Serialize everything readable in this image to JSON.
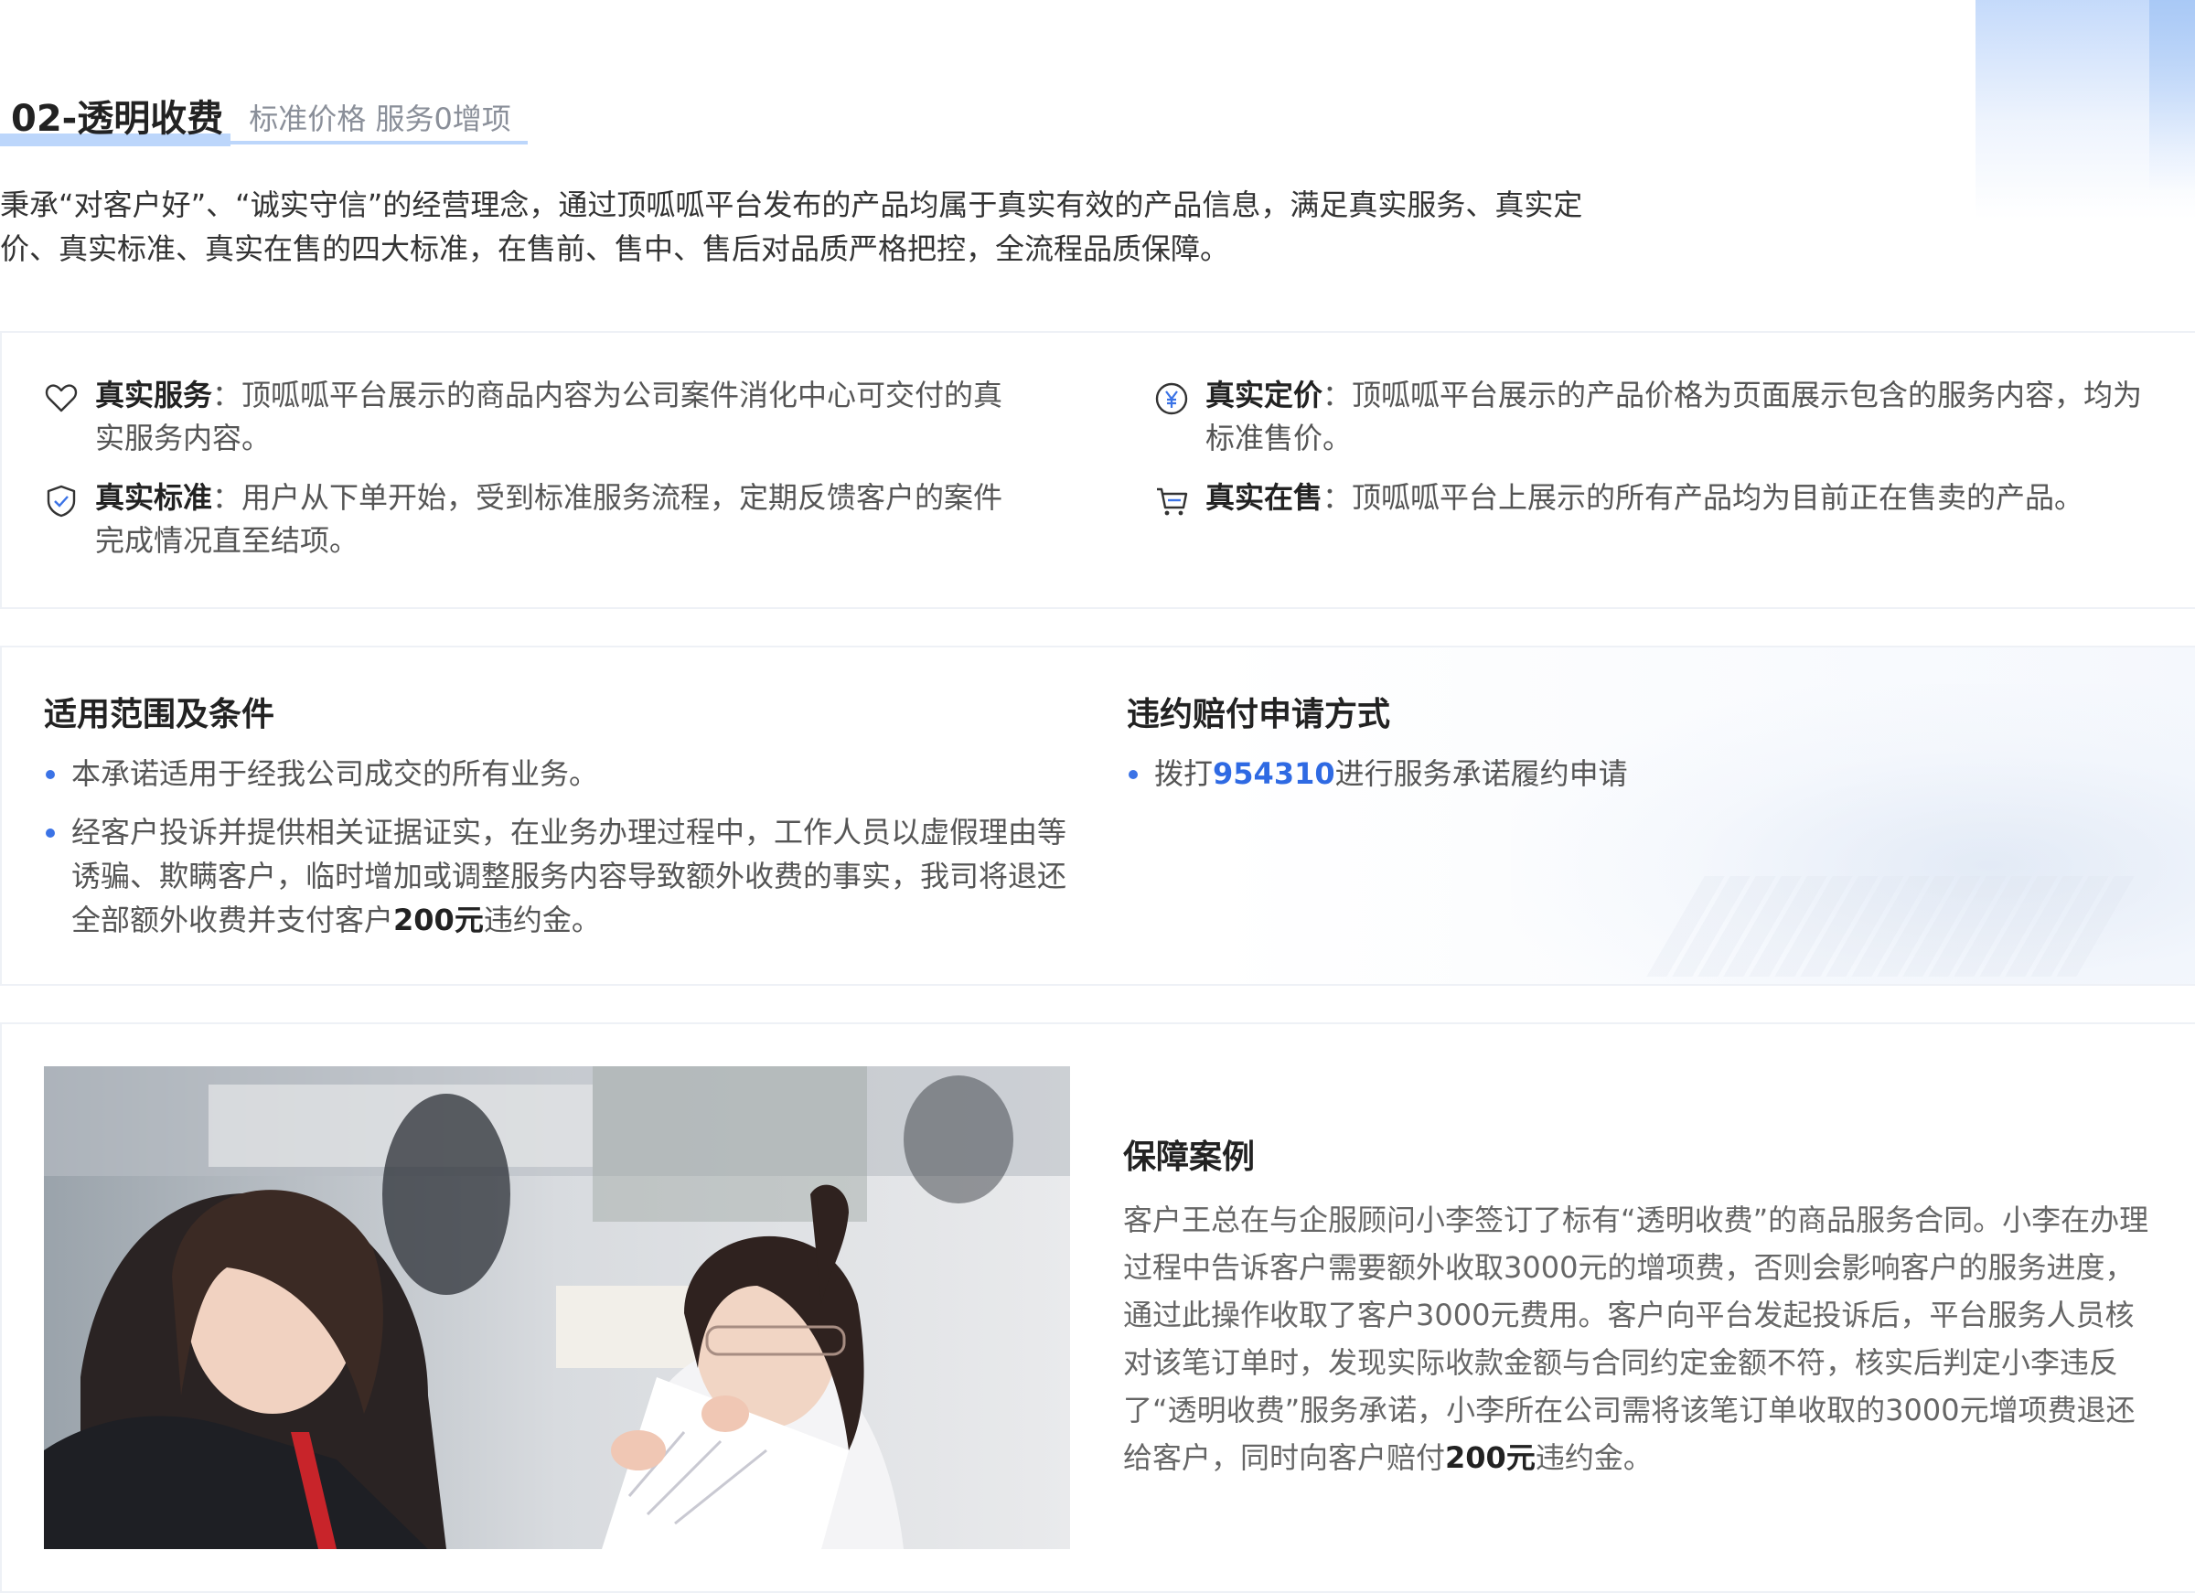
{
  "header": {
    "title": "02-透明收费",
    "subtitle": "标准价格 服务0增项"
  },
  "intro": "秉承“对客户好”、“诚实守信”的经营理念，通过顶呱呱平台发布的产品均属于真实有效的产品信息，满足真实服务、真实定价、真实标准、真实在售的四大标准，在售前、售中、售后对品质严格把控，全流程品质保障。",
  "features": [
    {
      "label": "真实服务",
      "sep": "：",
      "text": "顶呱呱平台展示的商品内容为公司案件消化中心可交付的真实服务内容。",
      "icon": "heart-icon"
    },
    {
      "label": "真实定价",
      "sep": "：",
      "text": "顶呱呱平台展示的产品价格为页面展示包含的服务内容，均为标准售价。",
      "icon": "yuan-icon"
    },
    {
      "label": "真实标准",
      "sep": "：",
      "text": "用户从下单开始，受到标准服务流程，定期反馈客户的案件完成情况直至结项。",
      "icon": "shield-check-icon"
    },
    {
      "label": "真实在售",
      "sep": "：",
      "text": "顶呱呱平台上展示的所有产品均为目前正在售卖的产品。",
      "icon": "cart-icon"
    }
  ],
  "scope": {
    "title": "适用范围及条件",
    "item1": "本承诺适用于经我公司成交的所有业务。",
    "item2_a": "经客户投诉并提供相关证据证实，在业务办理过程中，工作人员以虚假理由等诱骗、欺瞒客户，临时增加或调整服务内容导致额外收费的事实，我司将退还全部额外收费并支付客户",
    "item2_amount": "200元",
    "item2_b": "违约金。"
  },
  "claim": {
    "title": "违约赔付申请方式",
    "prefix": "拨打",
    "phone": "954310",
    "suffix": "进行服务承诺履约申请"
  },
  "case": {
    "title": "保障案例",
    "text_a": "客户王总在与企服顾问小李签订了标有“透明收费”的商品服务合同。小李在办理过程中告诉客户需要额外收取3000元的增项费，否则会影响客户的服务进度，通过此操作收取了客户3000元费用。客户向平台发起投诉后，平台服务人员核对该笔订单时，发现实际收款金额与合同约定金额不符，核实后判定小李违反了“透明收费”服务承诺，小李所在公司需将该笔订单收取的3000元增项费退还给客户，同时向客户赔付",
    "amount": "200元",
    "text_b": "违约金。"
  },
  "colors": {
    "accent": "#2f6ae3",
    "underline": "#bcd6fb",
    "bullet": "#3b73e6"
  }
}
